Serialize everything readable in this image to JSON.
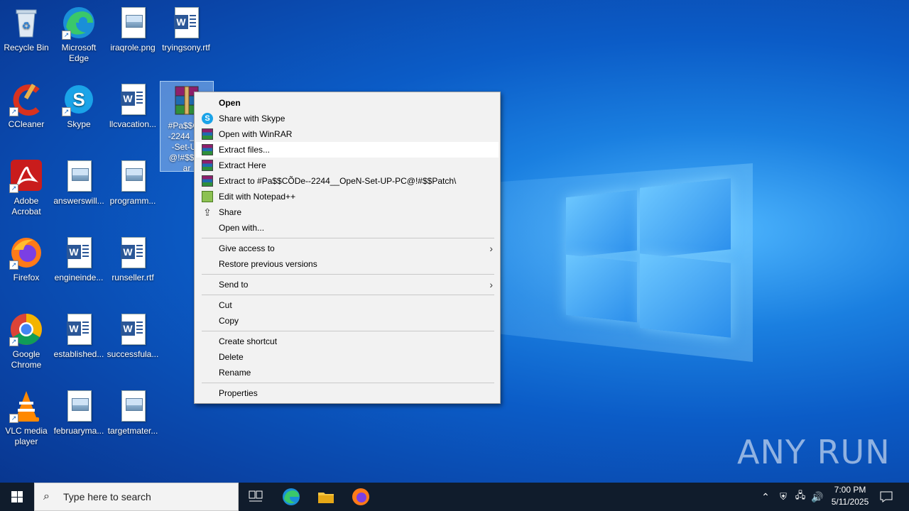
{
  "desktop": {
    "icons": [
      {
        "label": "Recycle Bin"
      },
      {
        "label": "Microsoft Edge"
      },
      {
        "label": "iraqrole.png"
      },
      {
        "label": "tryingsony.rtf"
      },
      {
        "label": "CCleaner"
      },
      {
        "label": "Skype"
      },
      {
        "label": "llcvacation..."
      },
      {
        "label": "#Pa$$CÕ\n-2244__C\n-Set-UP\n@!#$$Pa\nar"
      },
      {
        "label": "Adobe Acrobat"
      },
      {
        "label": "answerswill..."
      },
      {
        "label": "programm..."
      },
      {
        "label": "Firefox"
      },
      {
        "label": "engineinde..."
      },
      {
        "label": "runseller.rtf"
      },
      {
        "label": "Google Chrome"
      },
      {
        "label": "established..."
      },
      {
        "label": "successfula..."
      },
      {
        "label": "VLC media player"
      },
      {
        "label": "februaryma..."
      },
      {
        "label": "targetmater..."
      }
    ]
  },
  "context_menu": {
    "items": [
      {
        "label": "Open"
      },
      {
        "label": "Share with Skype"
      },
      {
        "label": "Open with WinRAR"
      },
      {
        "label": "Extract files..."
      },
      {
        "label": "Extract Here"
      },
      {
        "label": "Extract to #Pa$$CÕDe--2244__OpeN-Set-UP-PC@!#$$Patch\\"
      },
      {
        "label": "Edit with Notepad++"
      },
      {
        "label": "Share"
      },
      {
        "label": "Open with..."
      },
      {
        "label": "Give access to"
      },
      {
        "label": "Restore previous versions"
      },
      {
        "label": "Send to"
      },
      {
        "label": "Cut"
      },
      {
        "label": "Copy"
      },
      {
        "label": "Create shortcut"
      },
      {
        "label": "Delete"
      },
      {
        "label": "Rename"
      },
      {
        "label": "Properties"
      }
    ]
  },
  "taskbar": {
    "search_placeholder": "Type here to search",
    "time": "7:00 PM",
    "date": "5/11/2025"
  },
  "watermark": "ANY RUN",
  "colors": {
    "accent": "#0b5cc7",
    "taskbar": "#101c2c",
    "menu_bg": "#f2f2f2"
  }
}
